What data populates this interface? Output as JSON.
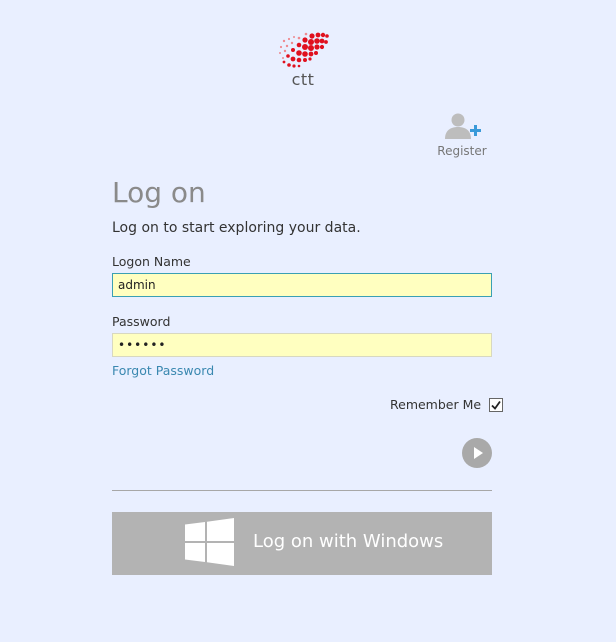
{
  "logo": {
    "text": "ctt",
    "icon": "ctt-logo-icon"
  },
  "register": {
    "label": "Register",
    "icon": "add-user-icon"
  },
  "form": {
    "title": "Log on",
    "subtitle": "Log on to start exploring your data.",
    "logon_name_label": "Logon Name",
    "logon_name_value": "admin",
    "password_label": "Password",
    "password_value": "••••••",
    "forgot_password": "Forgot Password",
    "remember_me_label": "Remember Me",
    "remember_me_checked": true,
    "submit_icon": "play-arrow-icon"
  },
  "windows_logon": {
    "label": "Log on with Windows",
    "icon": "windows-logo-icon"
  },
  "colors": {
    "background": "#e9efff",
    "input_fill": "#ffffc0",
    "link": "#3a88b0",
    "logo_red": "#e0101e",
    "button_gray": "#b3b3b3"
  }
}
